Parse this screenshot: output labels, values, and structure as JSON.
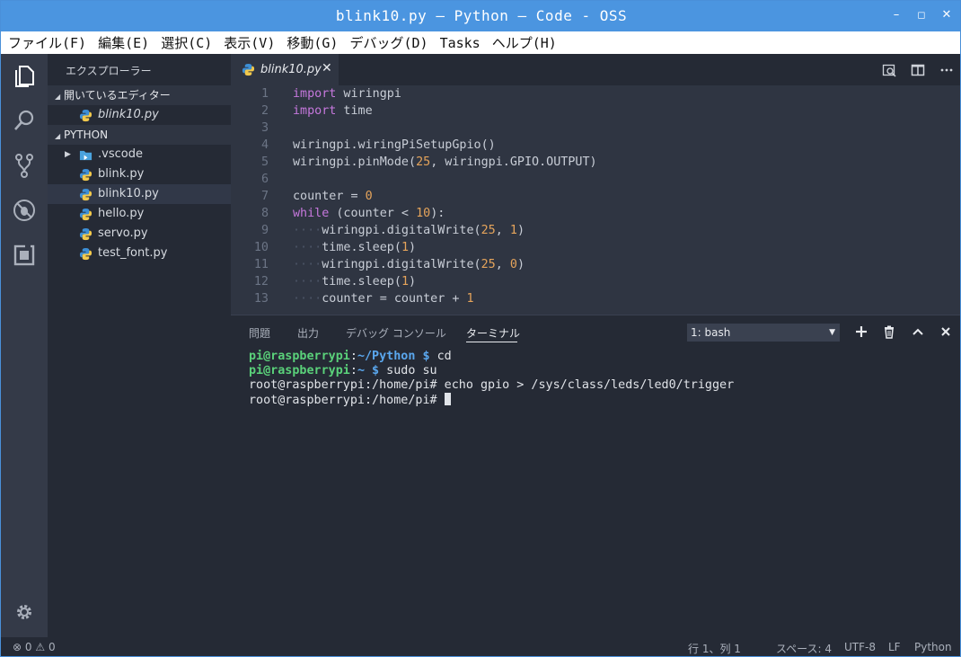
{
  "window": {
    "title": "blink10.py — Python — Code - OSS"
  },
  "menu": [
    "ファイル(F)",
    "編集(E)",
    "選択(C)",
    "表示(V)",
    "移動(G)",
    "デバッグ(D)",
    "Tasks",
    "ヘルプ(H)"
  ],
  "sidebar": {
    "header": "エクスプローラー",
    "open_editors_title": "開いているエディター",
    "open_editors": [
      "blink10.py"
    ],
    "folder_title": "PYTHON",
    "items": [
      ".vscode",
      "blink.py",
      "blink10.py",
      "hello.py",
      "servo.py",
      "test_font.py"
    ],
    "selected": "blink10.py"
  },
  "editor": {
    "tab_label": "blink10.py",
    "line_numbers": [
      "1",
      "2",
      "3",
      "4",
      "5",
      "6",
      "7",
      "8",
      "9",
      "10",
      "11",
      "12",
      "13"
    ]
  },
  "panel": {
    "tabs": [
      "問題",
      "出力",
      "デバッグ コンソール",
      "ターミナル"
    ],
    "active_tab": "ターミナル",
    "terminal_select": "1: bash",
    "terminal": {
      "l1_user": "pi@raspberrypi",
      "l1_sep": ":",
      "l1_path": "~/Python $",
      "l1_cmd": " cd",
      "l2_user": "pi@raspberrypi",
      "l2_sep": ":",
      "l2_path": "~ $",
      "l2_cmd": " sudo su",
      "l3": "root@raspberrypi:/home/pi# echo gpio > /sys/class/leds/led0/trigger",
      "l4": "root@raspberrypi:/home/pi# "
    }
  },
  "status": {
    "errors": "0",
    "warnings": "0",
    "position": "行 1、列 1",
    "spaces": "スペース: 4",
    "encoding": "UTF-8",
    "eol": "LF",
    "language": "Python"
  },
  "colors": {
    "accent": "#4b95e0",
    "keyword": "#c678dd",
    "number": "#e5a45b",
    "prompt_user": "#5ad17a",
    "prompt_path": "#5aa7ee"
  }
}
